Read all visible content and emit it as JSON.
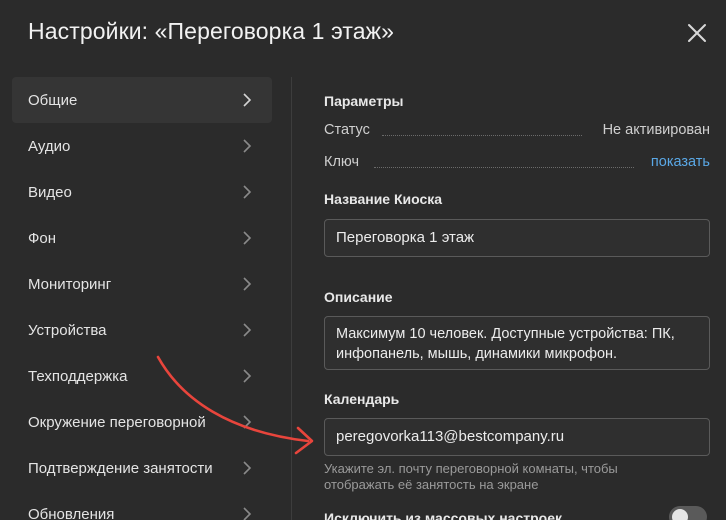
{
  "dialog": {
    "title": "Настройки: «Переговорка 1 этаж»",
    "close_icon": "close-icon"
  },
  "sidebar": {
    "items": [
      {
        "label": "Общие",
        "active": true
      },
      {
        "label": "Аудио",
        "active": false
      },
      {
        "label": "Видео",
        "active": false
      },
      {
        "label": "Фон",
        "active": false
      },
      {
        "label": "Мониторинг",
        "active": false
      },
      {
        "label": "Устройства",
        "active": false
      },
      {
        "label": "Техподдержка",
        "active": false
      },
      {
        "label": "Окружение переговорной",
        "active": false
      },
      {
        "label": "Подтверждение занятости",
        "active": false
      },
      {
        "label": "Обновления",
        "active": false
      }
    ]
  },
  "params": {
    "heading": "Параметры",
    "status_label": "Статус",
    "status_value": "Не активирован",
    "key_label": "Ключ",
    "key_action": "показать"
  },
  "kiosk_name": {
    "heading": "Название Киоска",
    "value": "Переговорка 1 этаж"
  },
  "description": {
    "heading": "Описание",
    "value_line1": "Максимум 10 человек. Доступные устройства: ПК,",
    "value_line2": "инфопанель, мышь, динамики микрофон."
  },
  "calendar": {
    "heading": "Календарь",
    "value": "peregovorka113@bestcompany.ru",
    "hint_line1": "Укажите эл. почту переговорной комнаты, чтобы",
    "hint_line2": "отображать её занятость на экране"
  },
  "exclude": {
    "heading": "Исключить из массовых настроек",
    "enabled": false
  },
  "colors": {
    "background": "#2b2b2b",
    "accent_link": "#5aa8e6",
    "annotation_arrow": "#e8453c"
  }
}
